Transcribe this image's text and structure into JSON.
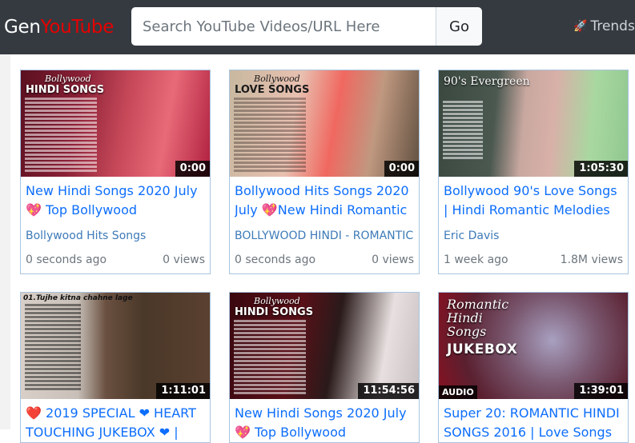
{
  "navbar": {
    "brand_part1": "Gen",
    "brand_part2": "YouTube",
    "search_placeholder": "Search YouTube Videos/URL Here",
    "search_value": "",
    "go_label": "Go",
    "trends_icon": "rocket-icon",
    "trends_label": "Trends"
  },
  "colors": {
    "navbar_bg": "#343a40",
    "brand_accent": "#e60000",
    "link": "#0d6efd",
    "card_border": "#a8c4e0"
  },
  "videos": [
    {
      "thumb_heading_script": "Bollywood",
      "thumb_heading": "HINDI SONGS",
      "duration": "0:00",
      "title_pre": "New Hindi Songs 2020 July ",
      "title_icon": "sparkling-heart-icon",
      "title_post": " Top Bollywood",
      "channel": "Bollywood Hits Songs",
      "age": "0 seconds ago",
      "views": "0 views"
    },
    {
      "thumb_heading_script": "Bollywood",
      "thumb_heading": "LOVE SONGS",
      "duration": "0:00",
      "title_pre": "Bollywood Hits Songs 2020 July ",
      "title_icon": "sparkling-heart-icon",
      "title_post": "New Hindi Romantic",
      "channel": "BOLLYWOOD HINDI - ROMANTIC",
      "age": "0 seconds ago",
      "views": "0 views"
    },
    {
      "thumb_heading_script": "90's Evergreen",
      "thumb_heading": "",
      "duration": "1:05:30",
      "title_pre": "Bollywood 90's Love Songs | Hindi Romantic Melodies",
      "title_icon": "",
      "title_post": "",
      "channel": "Eric Davis",
      "age": "1 week ago",
      "views": "1.8M views"
    },
    {
      "thumb_heading_script": "",
      "thumb_heading": "01.Tujhe kitna chahne lage",
      "duration": "1:11:01",
      "title_pre": "",
      "title_icon": "heart-icon",
      "title_post": " 2019 SPECIAL ❤ HEART TOUCHING JUKEBOX ❤ |",
      "channel": "",
      "age": "",
      "views": ""
    },
    {
      "thumb_heading_script": "Bollywood",
      "thumb_heading": "HINDI SONGS",
      "duration": "11:54:56",
      "title_pre": "New Hindi Songs 2020 July ",
      "title_icon": "sparkling-heart-icon",
      "title_post": " Top Bollywood",
      "channel": "",
      "age": "",
      "views": ""
    },
    {
      "thumb_heading_script": "Romantic Hindi Songs",
      "thumb_heading": "JUKEBOX",
      "audio_tag": "AUDIO",
      "duration": "1:39:01",
      "title_pre": "Super 20: ROMANTIC HINDI SONGS 2016 | Love Songs",
      "title_icon": "",
      "title_post": "",
      "channel": "",
      "age": "",
      "views": ""
    }
  ]
}
